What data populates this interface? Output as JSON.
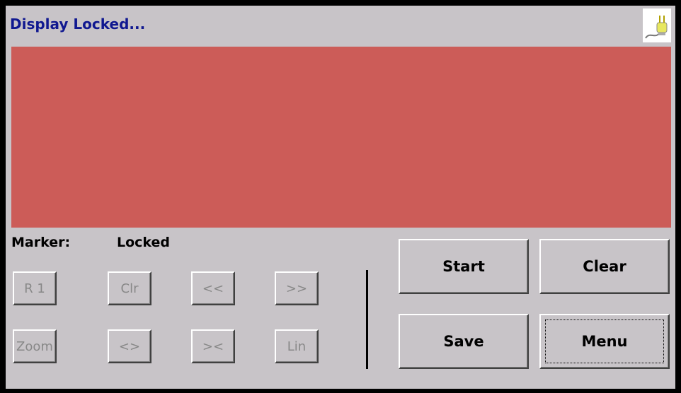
{
  "header": {
    "title": "Display Locked...",
    "status_icon": "power-plug-icon"
  },
  "marker": {
    "label": "Marker:",
    "value": "Locked"
  },
  "small_buttons": {
    "r1": "R 1",
    "clr": "Clr",
    "prev": "<<",
    "next": ">>",
    "zoom": "Zoom",
    "expand": "<>",
    "contract": "><",
    "lin": "Lin"
  },
  "big_buttons": {
    "start": "Start",
    "clear": "Clear",
    "save": "Save",
    "menu": "Menu"
  },
  "colors": {
    "graph_background": "#cc5c58",
    "title_color": "#101890",
    "panel": "#c8c4c8"
  }
}
